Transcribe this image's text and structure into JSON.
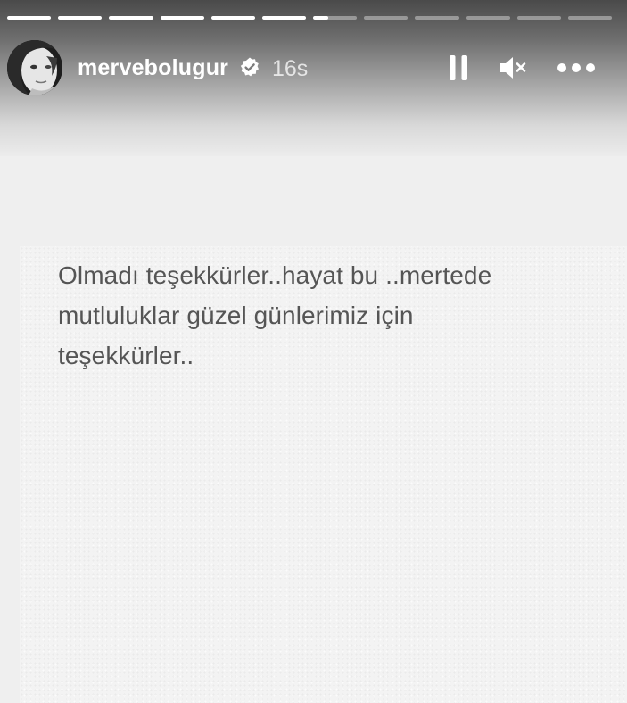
{
  "story": {
    "progress_segments": [
      1,
      1,
      1,
      1,
      1,
      1,
      0.35,
      0,
      0,
      0,
      0,
      0
    ],
    "colors": {
      "progress_filled": "#ffffff",
      "progress_empty": "rgba(255,255,255,0.38)",
      "text": "#555555",
      "background": "#efefef"
    }
  },
  "header": {
    "username": "mervebolugur",
    "verified": true,
    "verified_icon": "verified-badge-icon",
    "time_ago": "16s",
    "controls": {
      "pause_icon": "pause-icon",
      "mute_icon": "muted-speaker-icon",
      "more_icon": "more-options-icon"
    }
  },
  "content": {
    "lines": [
      "Olmadı teşekkürler..hayat bu ..mertede",
      "mutluluklar güzel günlerimiz için",
      "teşekkürler.."
    ]
  }
}
